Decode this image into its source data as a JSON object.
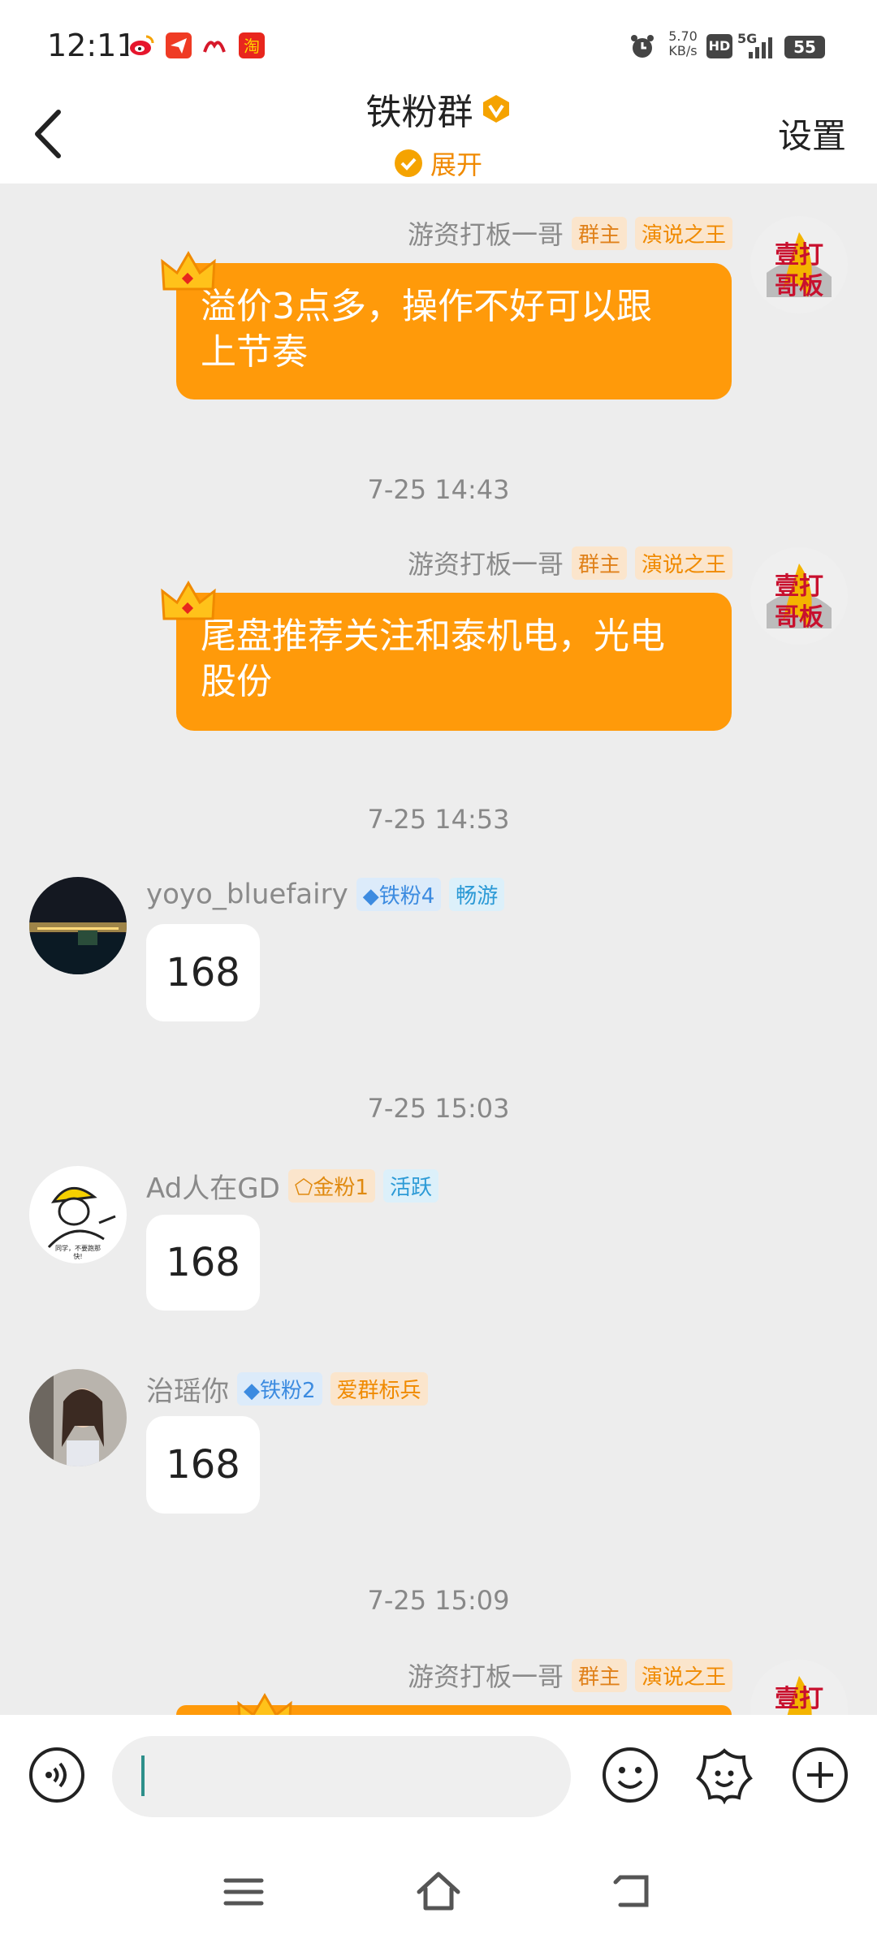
{
  "status": {
    "time": "12:11",
    "net_speed": "5.70",
    "net_unit": "KB/s",
    "hd": "HD",
    "signal": "5G",
    "battery": "55"
  },
  "header": {
    "title": "铁粉群",
    "expand": "展开",
    "settings": "设置"
  },
  "messages": [
    {
      "type": "owner",
      "name": "游资打板一哥",
      "tags": [
        "群主",
        "演说之王"
      ],
      "text_line1": "溢价3点多，操作不好可以跟",
      "text_line2": "上节奏"
    },
    {
      "type": "timestamp",
      "text": "7-25 14:43"
    },
    {
      "type": "owner",
      "name": "游资打板一哥",
      "tags": [
        "群主",
        "演说之王"
      ],
      "text_line1": "尾盘推荐关注和泰机电，光电",
      "text_line2": "股份"
    },
    {
      "type": "timestamp",
      "text": "7-25 14:53"
    },
    {
      "type": "member",
      "name": "yoyo_bluefairy",
      "tags": [
        "铁粉4",
        "畅游"
      ],
      "text": "168"
    },
    {
      "type": "timestamp",
      "text": "7-25 15:03"
    },
    {
      "type": "member",
      "name": "Ad人在GD",
      "tags": [
        "金粉1",
        "活跃"
      ],
      "text": "168"
    },
    {
      "type": "member",
      "name": "治瑶你",
      "tags": [
        "铁粉2",
        "爱群标兵"
      ],
      "text": "168"
    },
    {
      "type": "timestamp",
      "text": "7-25 15:09"
    },
    {
      "type": "owner",
      "name": "游资打板一哥",
      "tags": [
        "群主",
        "演说之王"
      ]
    }
  ],
  "avatar_text": {
    "owner_l1": "壹打",
    "owner_l2": "哥板",
    "ad_caption1": "同学，不要跑那",
    "ad_caption2": "快!"
  },
  "input": {
    "placeholder": "",
    "value": ""
  },
  "colors": {
    "accent": "#ff9a0a",
    "background": "#ededed",
    "link_orange": "#f08a00"
  }
}
